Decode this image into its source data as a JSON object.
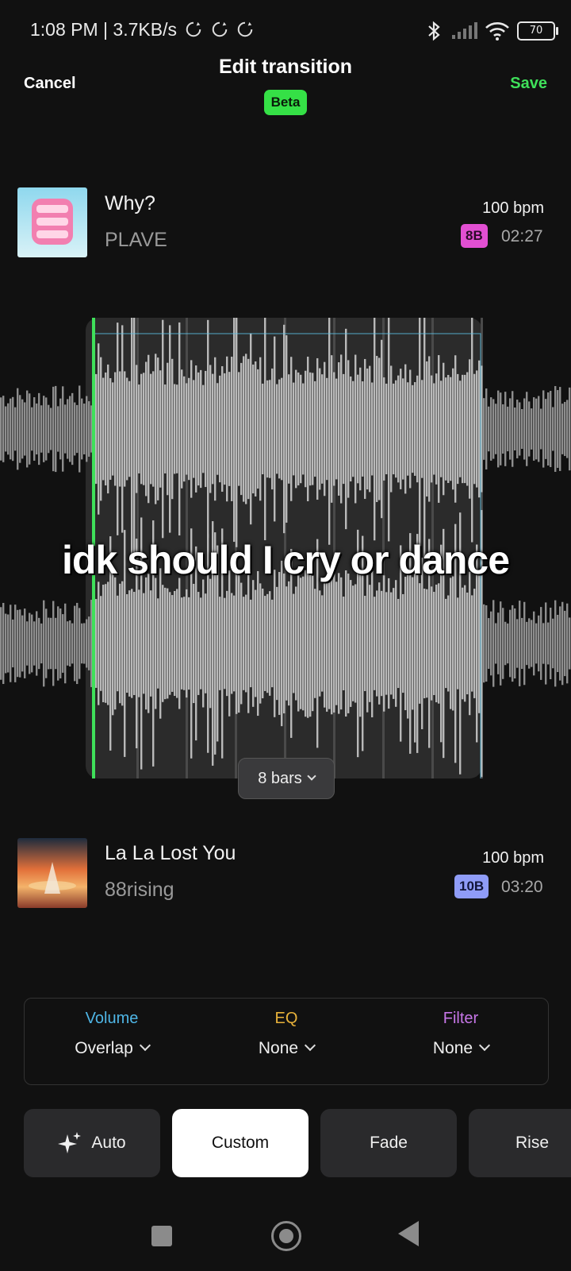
{
  "status": {
    "time_speed": "1:08 PM | 3.7KB/s",
    "battery": "70",
    "icons": [
      "sync-icon",
      "bluetooth-icon",
      "signal-icon",
      "wifi-icon",
      "battery-icon"
    ]
  },
  "header": {
    "cancel": "Cancel",
    "title": "Edit transition",
    "badge": "Beta",
    "save": "Save"
  },
  "track_from": {
    "title": "Why?",
    "artist": "PLAVE",
    "bpm": "100 bpm",
    "key": "8B",
    "duration": "02:27",
    "key_color": "#e24fd2"
  },
  "track_to": {
    "title": "La La Lost You",
    "artist": "88rising",
    "bpm": "100 bpm",
    "key": "10B",
    "duration": "03:20",
    "key_color": "#8f9cf7"
  },
  "waveform": {
    "bars_selector": "8 bars",
    "caption": "idk should I cry or dance",
    "playhead_color": "#3fe05a"
  },
  "controls": [
    {
      "label": "Volume",
      "value": "Overlap",
      "color": "#4fb6e6"
    },
    {
      "label": "EQ",
      "value": "None",
      "color": "#e8b23a"
    },
    {
      "label": "Filter",
      "value": "None",
      "color": "#c776e8"
    }
  ],
  "presets": [
    {
      "label": "Auto",
      "icon": "sparkle-icon",
      "active": false
    },
    {
      "label": "Custom",
      "active": true
    },
    {
      "label": "Fade",
      "active": false
    },
    {
      "label": "Rise",
      "active": false
    }
  ],
  "nav": [
    "recents-icon",
    "home-icon",
    "back-icon"
  ]
}
